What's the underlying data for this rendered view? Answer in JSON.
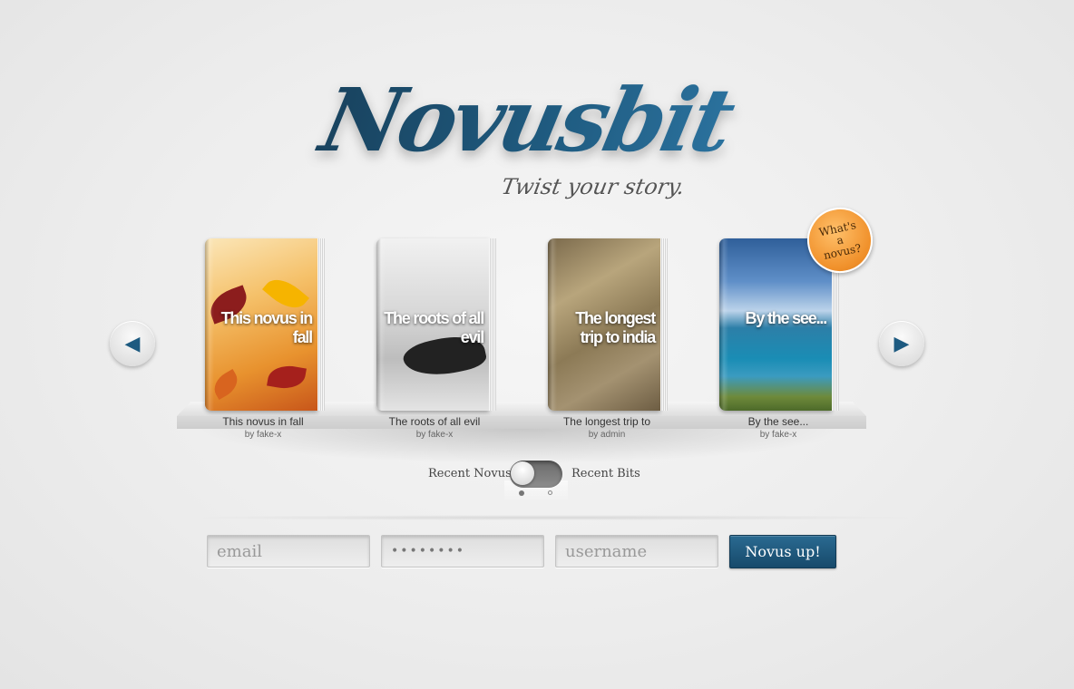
{
  "brand": {
    "logo_text": "Novusbit",
    "tagline": "Twist your story."
  },
  "badge": {
    "text": "What's a novus?"
  },
  "carousel": {
    "prev_icon": "◀",
    "next_icon": "▶",
    "books": [
      {
        "cover_title": "This novus in fall",
        "title": "This novus in fall",
        "author": "by fake-x"
      },
      {
        "cover_title": "The roots of all evil",
        "title": "The roots of all evil",
        "author": "by fake-x"
      },
      {
        "cover_title": "The longest trip to india",
        "title": "The longest trip to",
        "author": "by admin"
      },
      {
        "cover_title": "By the see...",
        "title": "By the see...",
        "author": "by fake-x"
      }
    ]
  },
  "toggle": {
    "left_label": "Recent Novus",
    "right_label": "Recent Bits",
    "active": "Recent Novus"
  },
  "signup": {
    "email_placeholder": "email",
    "password_value": "••••••••",
    "username_placeholder": "username",
    "submit_label": "Novus up!"
  },
  "colors": {
    "brand_blue": "#1d5a80",
    "badge_orange": "#f0902a"
  }
}
